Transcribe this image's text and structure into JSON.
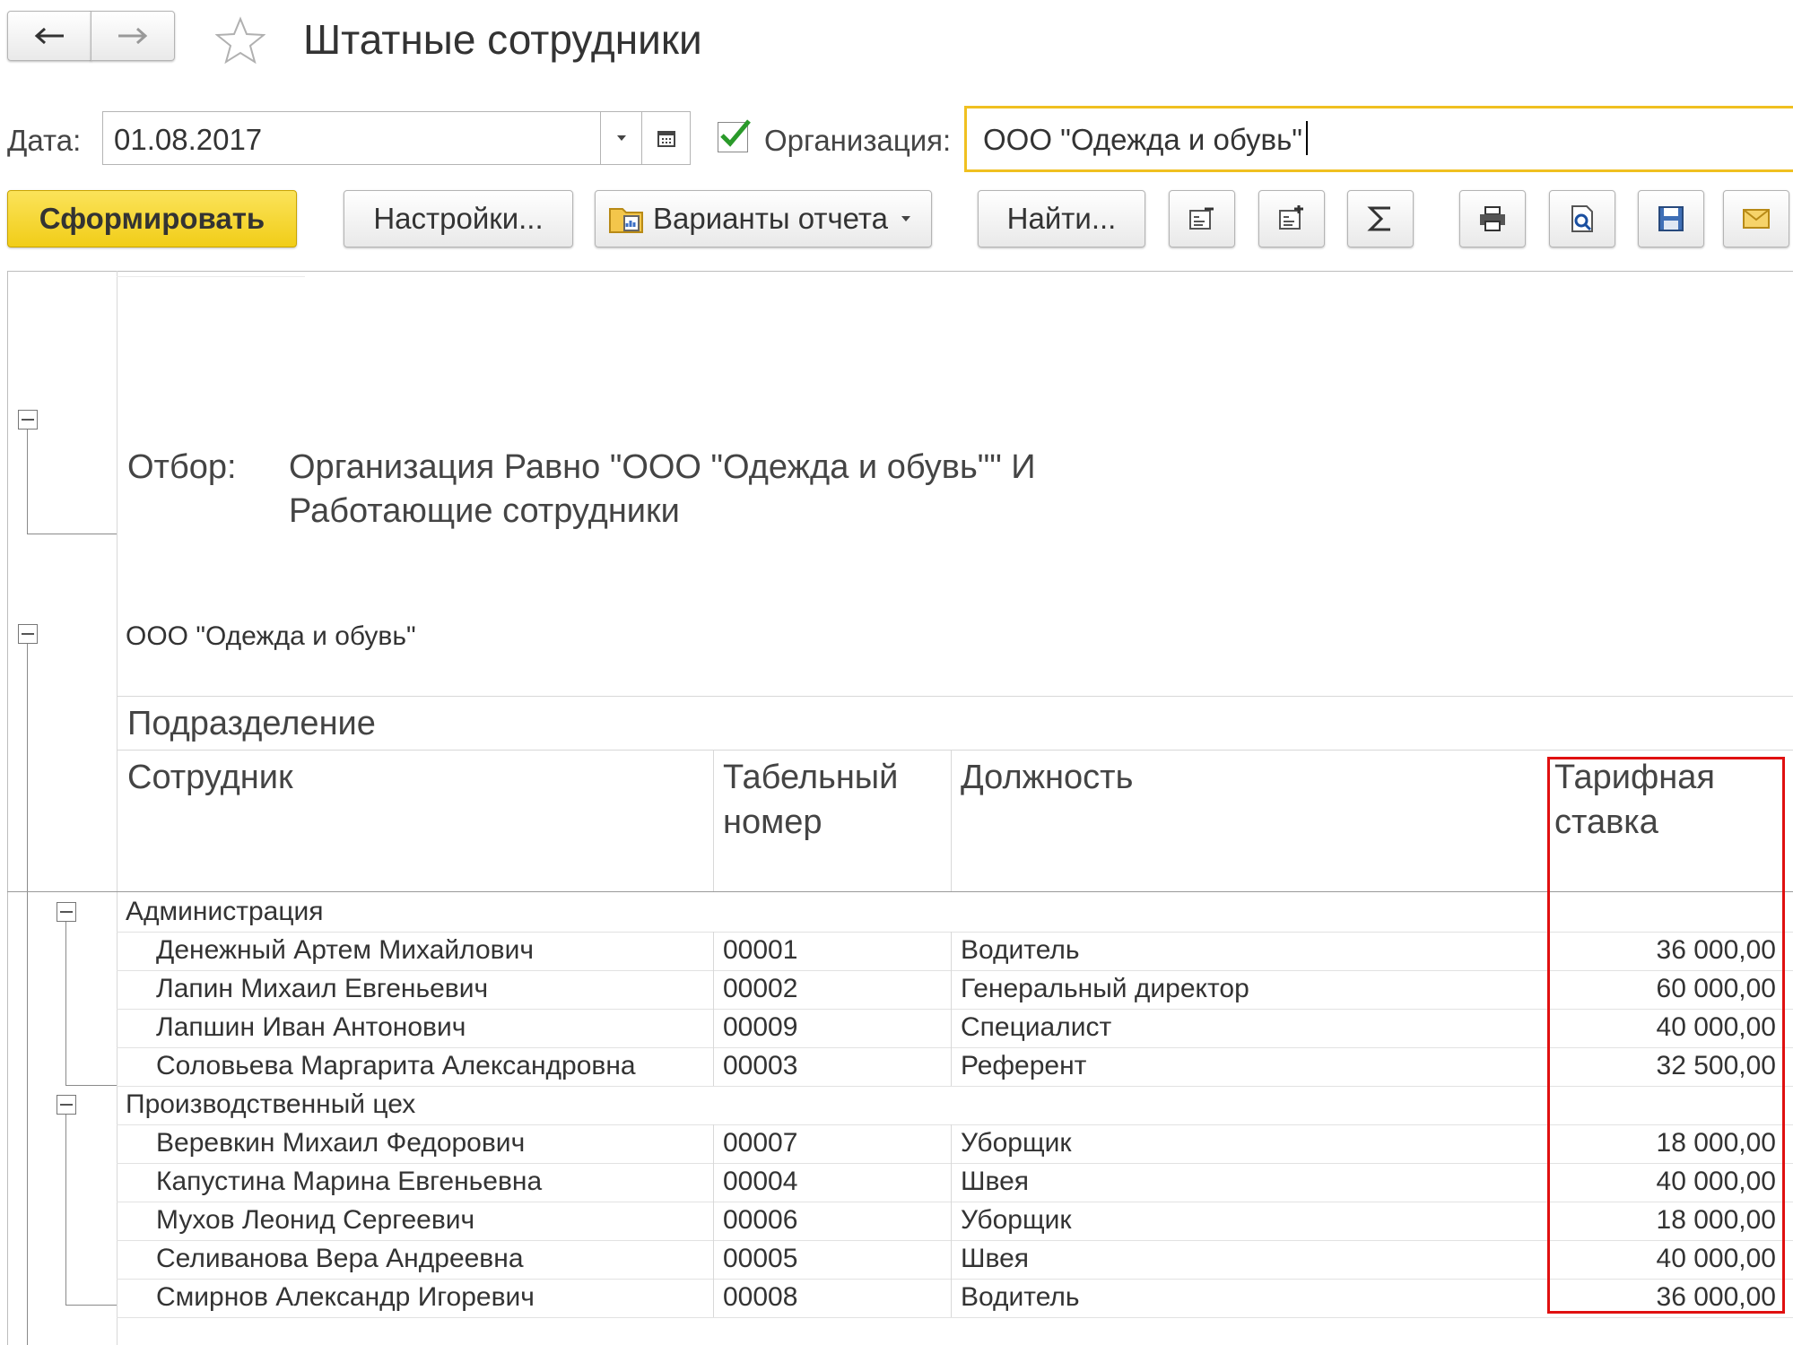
{
  "window": {
    "title": "Штатные сотрудники"
  },
  "filters": {
    "date_label": "Дата:",
    "date_value": "01.08.2017",
    "org_checked": true,
    "org_label": "Организация:",
    "org_value": "ООО \"Одежда и обувь\""
  },
  "toolbar": {
    "generate": "Сформировать",
    "settings": "Настройки...",
    "variants": "Варианты отчета",
    "find": "Найти..."
  },
  "report": {
    "filter_label": "Отбор:",
    "filter_line1": "Организация Равно \"ООО \"Одежда и обувь\"\" И",
    "filter_line2": "Работающие сотрудники",
    "org_name": "ООО \"Одежда и обувь\"",
    "headers": {
      "department": "Подразделение",
      "employee": "Сотрудник",
      "tab_number_1": "Табельный",
      "tab_number_2": "номер",
      "position": "Должность",
      "rate_1": "Тарифная",
      "rate_2": "ставка"
    },
    "rows": [
      {
        "group": "Администрация"
      },
      {
        "name": "Денежный Артем Михайлович",
        "tab": "00001",
        "position": "Водитель",
        "rate": "36 000,00"
      },
      {
        "name": "Лапин Михаил Евгеньевич",
        "tab": "00002",
        "position": "Генеральный директор",
        "rate": "60 000,00"
      },
      {
        "name": "Лапшин Иван Антонович",
        "tab": "00009",
        "position": "Специалист",
        "rate": "40 000,00"
      },
      {
        "name": "Соловьева Маргарита Александровна",
        "tab": "00003",
        "position": "Референт",
        "rate": "32 500,00"
      },
      {
        "group": "Производственный цех"
      },
      {
        "name": "Веревкин Михаил Федорович",
        "tab": "00007",
        "position": "Уборщик",
        "rate": "18 000,00"
      },
      {
        "name": "Капустина Марина Евгеньевна",
        "tab": "00004",
        "position": "Швея",
        "rate": "40 000,00"
      },
      {
        "name": "Мухов Леонид Сергеевич",
        "tab": "00006",
        "position": "Уборщик",
        "rate": "18 000,00"
      },
      {
        "name": "Селиванова Вера Андреевна",
        "tab": "00005",
        "position": "Швея",
        "rate": "40 000,00"
      },
      {
        "name": "Смирнов Александр Игоревич",
        "tab": "00008",
        "position": "Водитель",
        "rate": "36 000,00"
      }
    ]
  },
  "colors": {
    "generate_button": "#f5d530",
    "org_field_border": "#f0c020",
    "highlight_border": "#e01010"
  }
}
